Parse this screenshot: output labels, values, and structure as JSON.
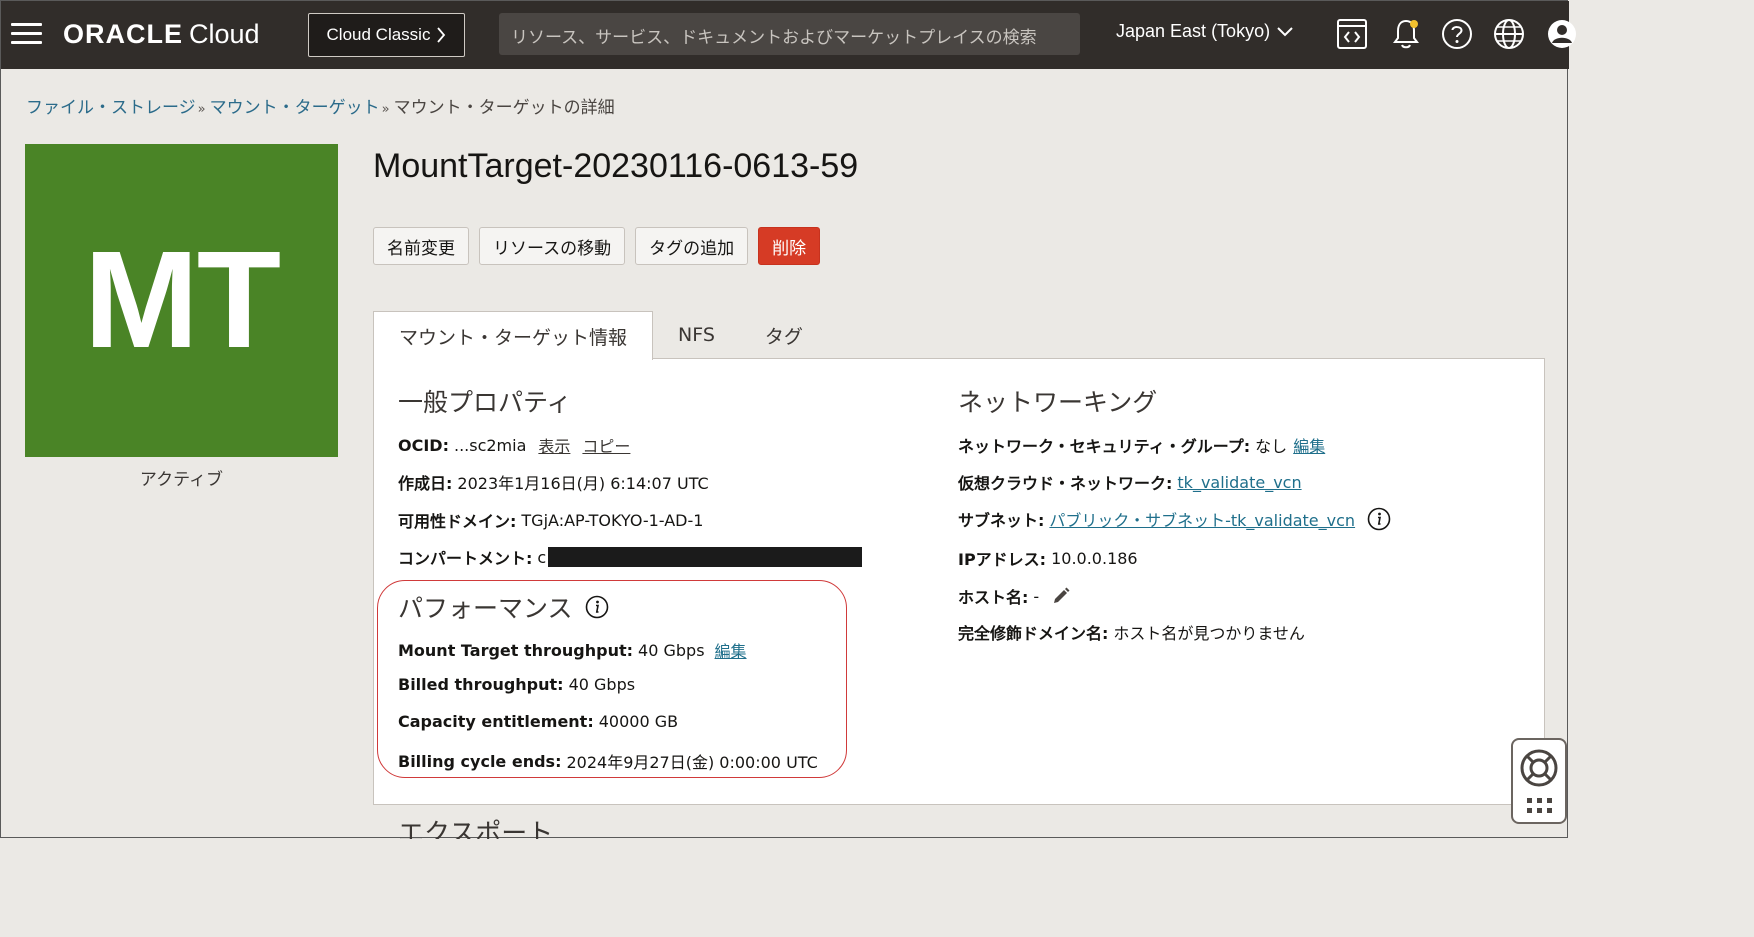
{
  "header": {
    "brand_oracle": "ORACLE",
    "brand_cloud": "Cloud",
    "classic_button": "Cloud Classic",
    "search_placeholder": "リソース、サービス、ドキュメントおよびマーケットプレイスの検索",
    "region": "Japan East (Tokyo)",
    "icons": [
      "menu-icon",
      "code-editor-icon",
      "bell-icon",
      "help-icon",
      "globe-icon",
      "profile-icon"
    ]
  },
  "breadcrumb": {
    "items": [
      "ファイル・ストレージ",
      "マウント・ターゲット"
    ],
    "separator": "»",
    "current": "マウント・ターゲットの詳細"
  },
  "resource": {
    "avatar_text": "MT",
    "avatar_color": "#4a8426",
    "state": "アクティブ",
    "title": "MountTarget-20230116-0613-59"
  },
  "actions": {
    "rename": "名前変更",
    "move": "リソースの移動",
    "add_tags": "タグの追加",
    "delete": "削除"
  },
  "tabs": [
    {
      "label": "マウント・ターゲット情報",
      "active": true
    },
    {
      "label": "NFS",
      "active": false
    },
    {
      "label": "タグ",
      "active": false
    }
  ],
  "general": {
    "title": "一般プロパティ",
    "ocid_label": "OCID:",
    "ocid_value": "...sc2mia",
    "ocid_show": "表示",
    "ocid_copy": "コピー",
    "created_label": "作成日:",
    "created_value": "2023年1月16日(月) 6:14:07 UTC",
    "ad_label": "可用性ドメイン:",
    "ad_value": "TGjA:AP-TOKYO-1-AD-1",
    "compartment_label": "コンパートメント:",
    "compartment_value": "c"
  },
  "performance": {
    "title": "パフォーマンス",
    "throughput_label": "Mount Target throughput:",
    "throughput_value": "40 Gbps",
    "throughput_edit": "編集",
    "billed_label": "Billed throughput:",
    "billed_value": "40 Gbps",
    "capacity_label": "Capacity entitlement:",
    "capacity_value": "40000 GB",
    "billing_label": "Billing cycle ends:",
    "billing_value": "2024年9月27日(金) 0:00:00 UTC"
  },
  "networking": {
    "title": "ネットワーキング",
    "nsg_label": "ネットワーク・セキュリティ・グループ:",
    "nsg_value": "なし",
    "nsg_edit": "編集",
    "vcn_label": "仮想クラウド・ネットワーク:",
    "vcn_value": "tk_validate_vcn",
    "subnet_label": "サブネット:",
    "subnet_value": "パブリック・サブネット-tk_validate_vcn",
    "ip_label": "IPアドレス:",
    "ip_value": "10.0.0.186",
    "hostname_label": "ホスト名:",
    "hostname_value": "-",
    "fqdn_label": "完全修飾ドメイン名:",
    "fqdn_value": "ホスト名が見つかりません"
  },
  "partial_heading": "エクスポート"
}
